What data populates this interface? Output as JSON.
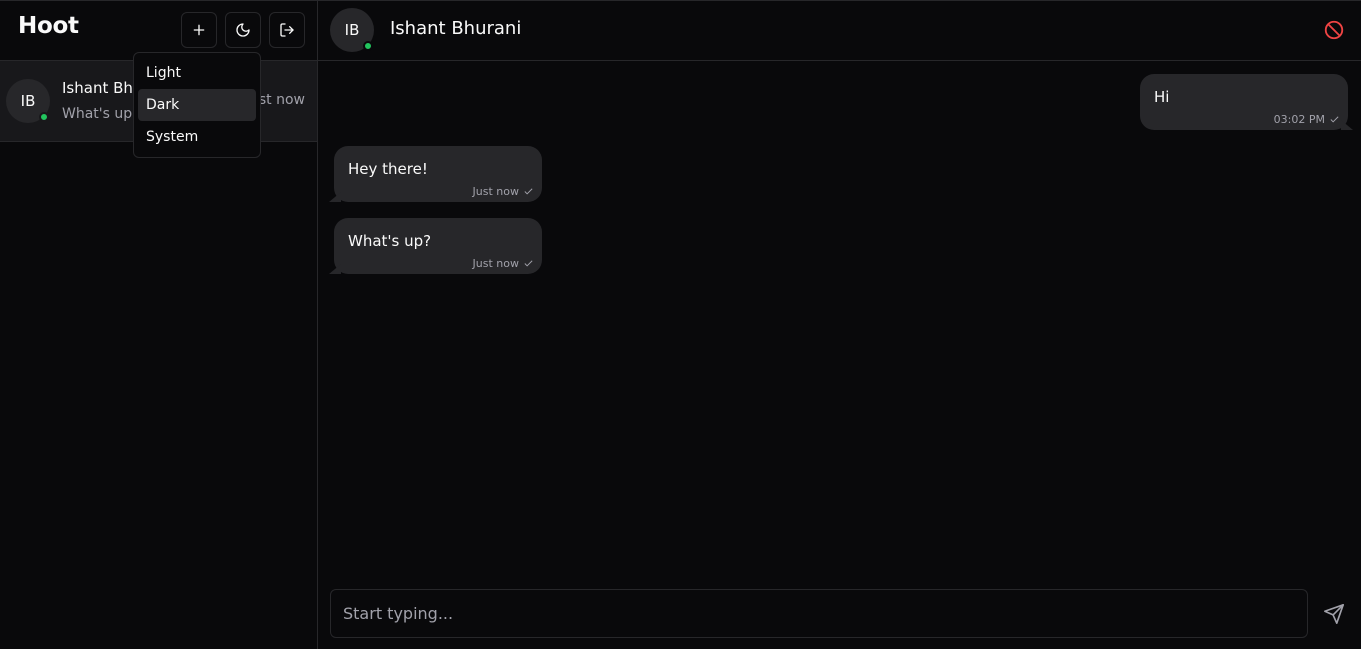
{
  "app": {
    "title": "Hoot"
  },
  "sidebar": {
    "buttons": {
      "new_chat_icon": "plus-icon",
      "theme_icon": "moon-icon",
      "logout_icon": "logout-icon"
    },
    "theme_menu": {
      "items": [
        {
          "label": "Light",
          "active": false
        },
        {
          "label": "Dark",
          "active": true
        },
        {
          "label": "System",
          "active": false
        }
      ]
    },
    "chats": [
      {
        "initials": "IB",
        "name": "Ishant Bhurani",
        "preview": "What's up?",
        "time": "Just now",
        "online": true
      }
    ]
  },
  "conversation": {
    "contact": {
      "initials": "IB",
      "name": "Ishant Bhurani",
      "online": true
    },
    "block_icon": "block-icon",
    "messages": [
      {
        "text": "Hi",
        "time": "03:02 PM",
        "outgoing": true
      },
      {
        "text": "Hey there!",
        "time": "Just now",
        "outgoing": false
      },
      {
        "text": "What's up?",
        "time": "Just now",
        "outgoing": false
      }
    ],
    "composer": {
      "placeholder": "Start typing..."
    },
    "send_icon": "send-icon"
  },
  "colors": {
    "background": "#09090b",
    "surface": "#18181b",
    "bubble": "#27272a",
    "online": "#22c55e",
    "danger": "#ef4444"
  }
}
